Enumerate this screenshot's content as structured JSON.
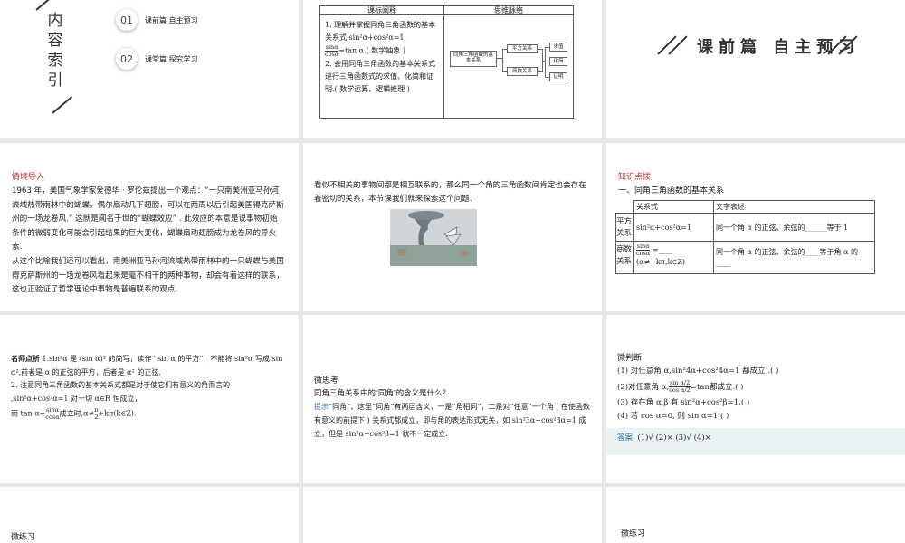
{
  "slide1": {
    "vertical_title": [
      "内",
      "容",
      "索",
      "引"
    ],
    "items": [
      {
        "num": "01",
        "label": "课前篇 自主预习"
      },
      {
        "num": "02",
        "label": "课堂篇 探究学习"
      }
    ]
  },
  "slide2": {
    "header_left": "课标阐释",
    "header_right": "思维脉络",
    "p1_title": "1. 理解并掌握同角三角函数的基本关系式",
    "p1_formula": "sin²α+cos²α=1,",
    "p1_frac_num": "sinα",
    "p1_frac_den": "cosα",
    "p1_rest": "=tan α.( 数学抽象 )",
    "p2": "2. 会用同角三角函数的基本关系式进行三角函数式的求值、化简和证明.( 数学运算、逻辑推理 )",
    "map_root": "同角三角函数的基本关系",
    "map_mid1": "平方关系",
    "map_mid2": "商数关系",
    "map_leaf1": "求值",
    "map_leaf2": "化简",
    "map_leaf3": "证明"
  },
  "slide3": {
    "title": "课前篇 自主预习"
  },
  "slide4": {
    "heading": "情境导入",
    "p1": "1963 年，美国气象学家爱德华 · 罗伦兹提出一个观点：“一只南美洲亚马孙河流域热带雨林中的蝴蝶，偶尔扇动几下翅膀，可以在两周以后引起美国得克萨斯州的一场龙卷风.” 这就是闻名于世的“蝴蝶效应” . 此效应的本意是说事物初始条件的微弱变化可能会引起结果的巨大变化，蝴蝶扇动翅膀成为龙卷风的导火索.",
    "p2": "从这个比喻我们还可以看出，南美洲亚马孙河流域热带雨林中的一只蝴蝶与美国得克萨斯州的一场龙卷风看起来是毫不相干的两种事物，却会有着这样的联系，这也正验证了哲学理论中事物是普遍联系的观点."
  },
  "slide5": {
    "text": "看似不相关的事物间都是相互联系的，那么同一个角的三角函数间肯定也会存在着密切的关系，本节课我们就来探索这个问题."
  },
  "slide6": {
    "heading": "知识点拨",
    "subheading": "一、同角三角函数的基本关系",
    "col1": "关系式",
    "col2": "文字表述",
    "row1_name": "平方关系",
    "row1_formula": "sin²α+cos²α=1",
    "row1_text_a": "同一个角 α 的正弦、余弦的",
    "row1_blank": "______",
    "row1_text_b": "等于 1",
    "row2_name": "商数关系",
    "row2_frac_num": "sinα",
    "row2_frac_den": "cosα",
    "row2_formula_tail": "=____",
    "row2_cond": "(α≠+kπ,k∈Z)",
    "row2_text_a": "同一个角 α 的正弦、余弦的",
    "row2_blank": "____",
    "row2_text_b": "等于角 α 的",
    "row2_text_c": "____"
  },
  "slide7": {
    "heading": "名师点析",
    "p1_rest": "1.sin²α 是 (sin α)² 的简写，读作“ sin α 的平方”，不能将 sin²α 写成 sin α²,前者是 α 的正弦的平方，后者是 α² 的正弦.",
    "p2": "2. 注意同角三角函数的基本关系式都是对于使它们有意义的角而言的 ,sin²α+cos²α=1 对一切 α∈R 恒成立，",
    "p3_a": "而 tan α=",
    "p3_num": "sinα",
    "p3_den": "cosα",
    "p3_b": "成立时,α≠",
    "p3_num2": "π",
    "p3_den2": "2",
    "p3_c": "+kπ(k∈Z)."
  },
  "slide8": {
    "heading": "微思考",
    "question": "同角三角关系中的“同角”的含义是什么？",
    "hint_label": "提示",
    "hint": "“同角”，这里“同角”有两层含义，一是“角相同”，二是对“任意”一个角 ( 在使函数有意义的前提下 ) 关系式都成立，即与角的表达形式无关，如 sin²3α+cos²3α=1 成立，但是 sin²α+cos²β=1 就不一定成立."
  },
  "slide9": {
    "heading": "微判断",
    "q1": "(1) 对任意角 α,sin²4α+cos²4α=1 都成立 .(        )",
    "q2_a": "(2)对任意角 α,",
    "q2_num": "sin α/2",
    "q2_den": "cos α/2",
    "q2_b": "=tan",
    "q2_c": "都成立.(        )",
    "q3": "(3) 存在角 α,β 有 sin²α+cos²β=1.(        )",
    "q4": "(4) 若 cos α=0, 则 sin α=1.(        )",
    "answer_label": "答案",
    "answers": "(1)√     (2)×     (3)√     (4)×"
  },
  "slide10": {
    "heading": "微练习"
  },
  "slide12": {
    "heading": "微练习"
  }
}
